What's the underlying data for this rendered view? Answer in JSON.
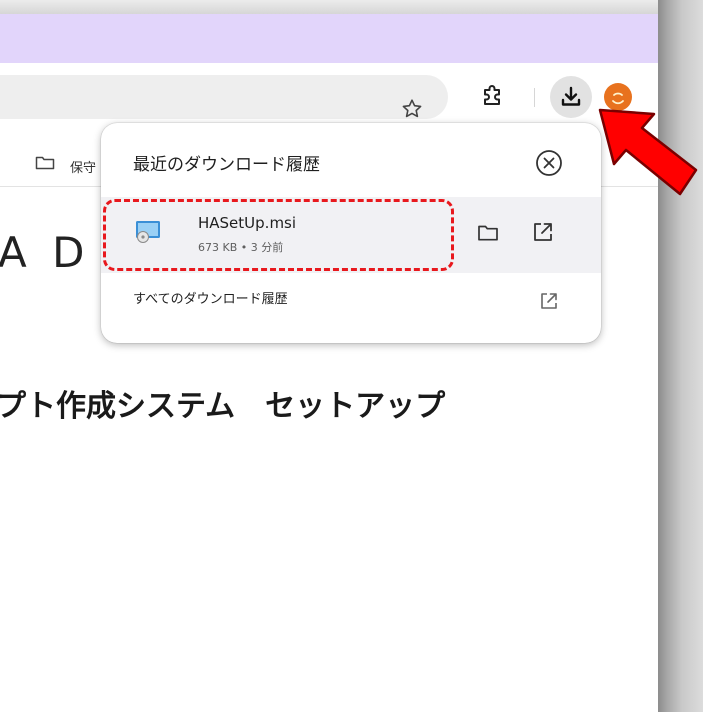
{
  "popup": {
    "title": "最近のダウンロード履歴",
    "item": {
      "file_name": "HASetUp.msi",
      "meta": "673 KB • 3 分前"
    },
    "all_downloads_label": "すべてのダウンロード履歴"
  },
  "bookmarks": {
    "folder_label": "保守"
  },
  "page": {
    "logo_partial": "A D",
    "heading_partial": "プト作成システム　セットアップ"
  },
  "icons": {
    "star": "star-icon",
    "extensions": "puzzle-icon",
    "downloads": "download-icon",
    "profile": "avatar",
    "close": "close-circle-icon",
    "folder": "folder-icon",
    "open": "open-external-icon",
    "file": "msi-installer-icon"
  },
  "colors": {
    "titlebar": "#e2d5fb",
    "download_button_bg": "#e2e2e2",
    "avatar": "#e8721e",
    "highlight": "#e8181d",
    "arrow": "#ff0000",
    "row_bg": "#f1f1f4"
  }
}
